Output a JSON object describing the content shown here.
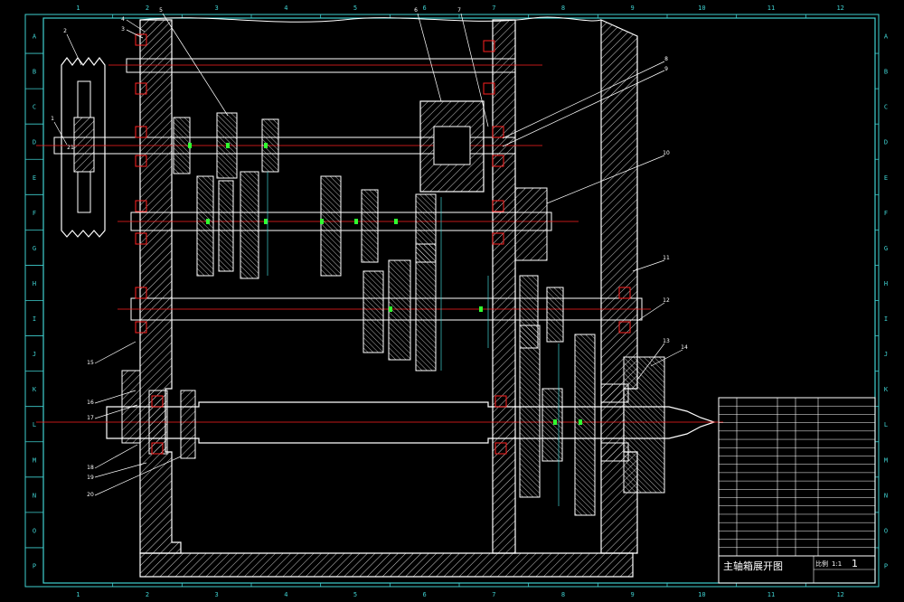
{
  "drawing": {
    "title": "主轴箱展开图",
    "sheet_number": "1",
    "column_zones": [
      "1",
      "2",
      "3",
      "4",
      "5",
      "6",
      "7",
      "8",
      "9",
      "10",
      "11",
      "12"
    ],
    "row_zones": [
      "A",
      "B",
      "C",
      "D",
      "E",
      "F",
      "G",
      "H",
      "I",
      "J",
      "K",
      "L",
      "M",
      "N",
      "O",
      "P"
    ],
    "callouts": [
      "1",
      "2",
      "3",
      "4",
      "5",
      "6",
      "7",
      "8",
      "9",
      "10",
      "11",
      "12",
      "13",
      "14",
      "15",
      "16",
      "17",
      "18",
      "19",
      "20",
      "21"
    ]
  },
  "colors": {
    "background": "#000000",
    "outline": "#ffffff",
    "section_hatch": "#ffffff",
    "center_line": "#ff2020",
    "frame_cyan": "#3fd0d0",
    "dimension_green": "#30ff30",
    "leader_line": "#ffffff"
  },
  "title_block": {
    "scale_label": "比例",
    "scale": "1:1",
    "row_count": 19
  }
}
